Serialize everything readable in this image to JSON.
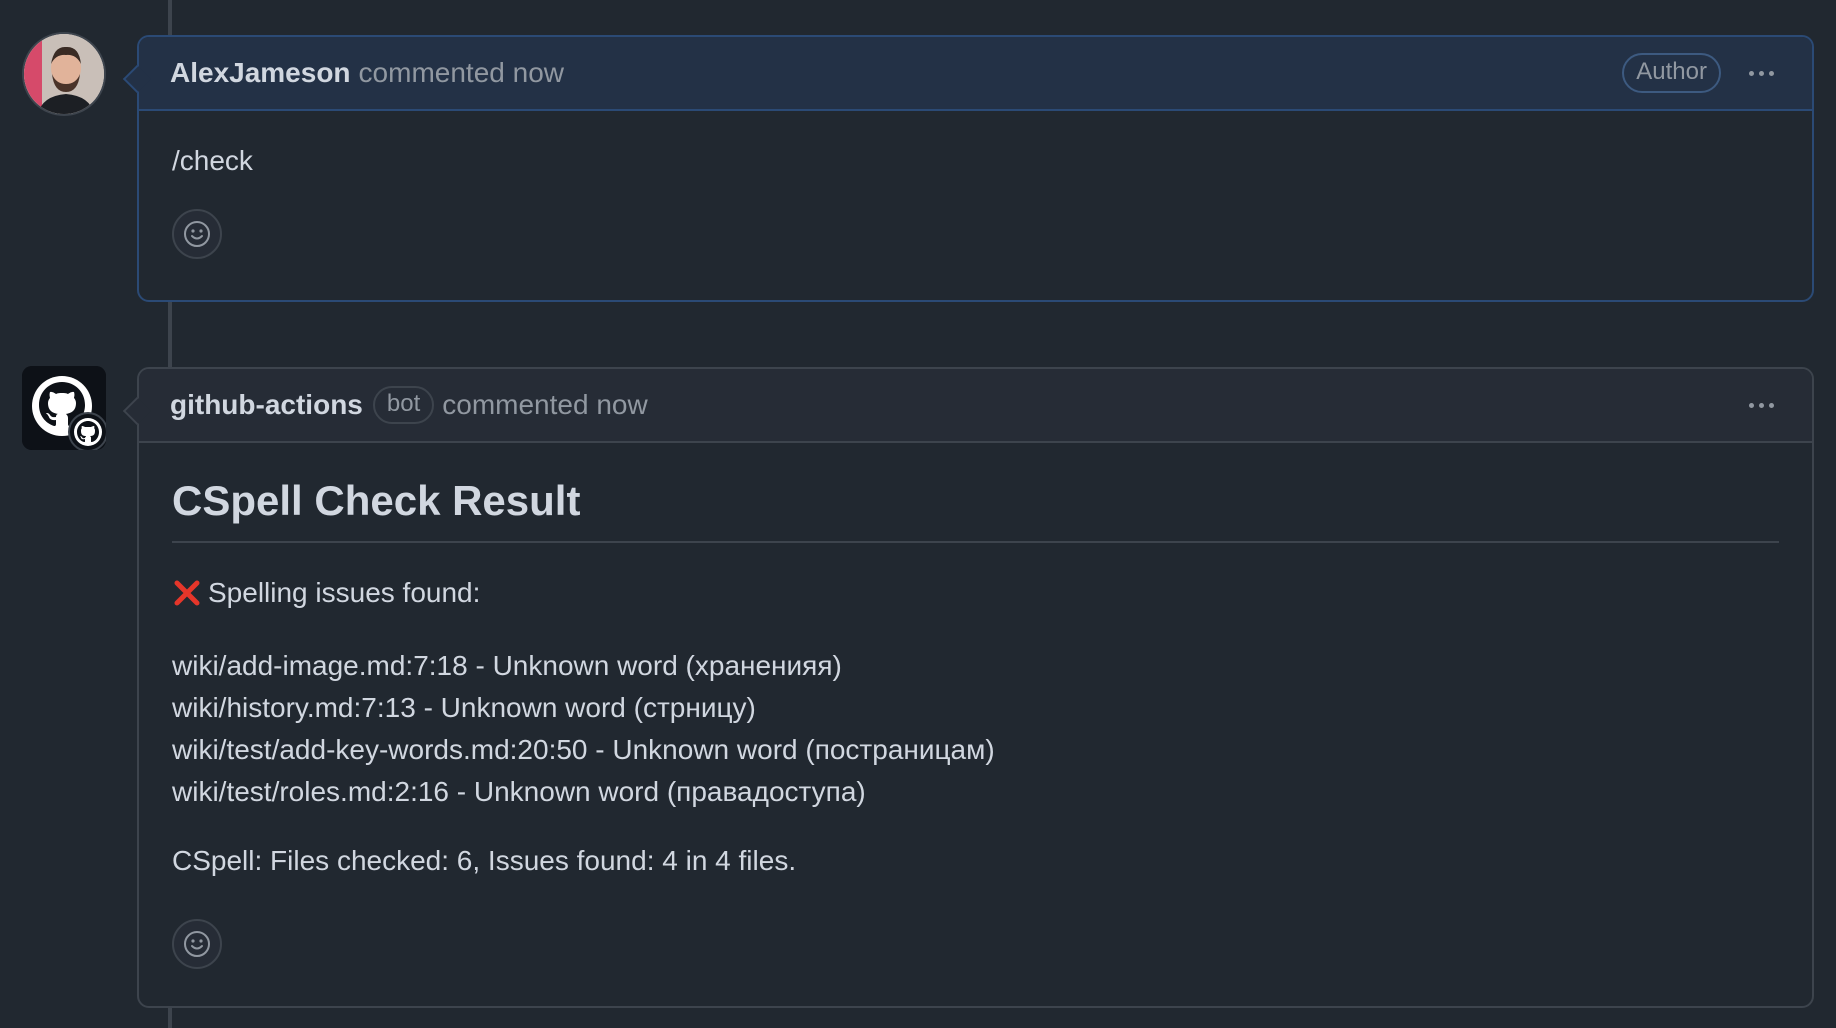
{
  "comments": [
    {
      "author": "AlexJameson",
      "meta": "commented now",
      "badge": "Author",
      "body": "/check"
    },
    {
      "author": "github-actions",
      "bot_badge": "bot",
      "meta": "commented now",
      "heading": "CSpell Check Result",
      "status": "Spelling issues found:",
      "issues": [
        "wiki/add-image.md:7:18 - Unknown word (храненияя)",
        "wiki/history.md:7:13 - Unknown word (стрницу)",
        "wiki/test/add-key-words.md:20:50 - Unknown word (постраницам)",
        "wiki/test/roles.md:2:16 - Unknown word (правадоступа)"
      ],
      "summary": "CSpell: Files checked: 6, Issues found: 4 in 4 files."
    }
  ],
  "icons": {
    "more": "kebab-horizontal-icon",
    "reaction": "smiley-icon",
    "error": "cross-mark-icon",
    "bot_avatar": "github-octocat-icon"
  },
  "colors": {
    "background": "#212830",
    "author_header": "#233146",
    "error_red": "#e5362a"
  }
}
